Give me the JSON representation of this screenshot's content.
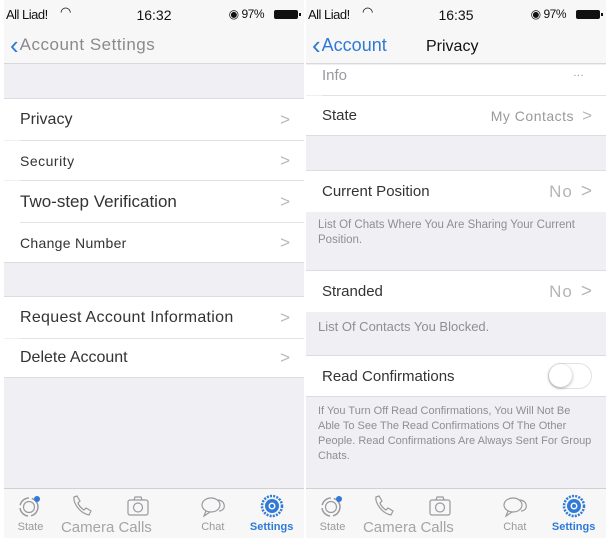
{
  "left_screen": {
    "status": {
      "carrier": "All Liad!",
      "time": "16:32",
      "battery": "97%"
    },
    "nav": {
      "back_label": "Account Settings"
    },
    "groups": [
      {
        "items": [
          {
            "label": "Privacy"
          },
          {
            "label": "Security"
          },
          {
            "label": "Two-step Verification"
          },
          {
            "label": "Change Number"
          }
        ]
      },
      {
        "items": [
          {
            "label": "Request Account Information"
          },
          {
            "label": "Delete Account"
          }
        ]
      }
    ],
    "chevron": ">",
    "tabs": [
      {
        "label": "State",
        "icon": "status-icon"
      },
      {
        "label": "Camera Calls",
        "icon": "phone-icon"
      },
      {
        "label": "",
        "icon": "camera-icon"
      },
      {
        "label": "Chat",
        "icon": "chat-icon"
      },
      {
        "label": "Settings",
        "icon": "settings-icon",
        "active": true
      }
    ]
  },
  "right_screen": {
    "status": {
      "carrier": "All Liad!",
      "time": "16:35",
      "battery": "97%"
    },
    "nav": {
      "back_label": "Account",
      "title": "Privacy"
    },
    "info_row": {
      "label": "Info",
      "value": "..."
    },
    "state_row": {
      "label": "State",
      "value": "My Contacts"
    },
    "position_row": {
      "label": "Current Position",
      "value": "No"
    },
    "position_footer": "List Of Chats Where You Are Sharing Your Current Position.",
    "stranded_row": {
      "label": "Stranded",
      "value": "No"
    },
    "stranded_footer": "List Of Contacts You Blocked.",
    "read_row": {
      "label": "Read Confirmations",
      "toggle_on": false
    },
    "read_footer": "If You Turn Off Read Confirmations, You Will Not Be Able To See The Read Confirmations Of The Other People. Read Confirmations Are Always Sent For Group Chats.",
    "chevron": ">",
    "tabs": [
      {
        "label": "State",
        "icon": "status-icon"
      },
      {
        "label": "Camera Calls",
        "icon": "phone-icon"
      },
      {
        "label": "",
        "icon": "camera-icon"
      },
      {
        "label": "Chat",
        "icon": "chat-icon"
      },
      {
        "label": "Settings",
        "icon": "settings-icon",
        "active": true
      }
    ]
  },
  "colors": {
    "accent": "#2f7ad6",
    "background": "#efeff4",
    "cell": "#ffffff",
    "secondary_text": "#8e8e93"
  }
}
